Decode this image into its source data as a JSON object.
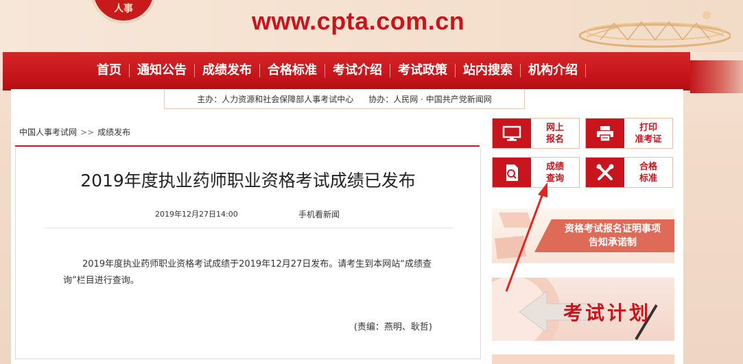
{
  "header": {
    "seal_text": "人事",
    "site_url": "www.cpta.com.cn"
  },
  "nav": {
    "items": [
      "首页",
      "通知公告",
      "成绩发布",
      "合格标准",
      "考试介绍",
      "考试政策",
      "站内搜索",
      "机构介绍"
    ]
  },
  "sponsors": {
    "host": "主办：人力资源和社会保障部人事考试中心",
    "co_host": "协办：人民网 · 中国共产党新闻网"
  },
  "breadcrumb": {
    "home": "中国人事考试网",
    "separator": ">>",
    "current": "成绩发布"
  },
  "article": {
    "title": "2019年度执业药师职业资格考试成绩已发布",
    "date": "2019年12月27日14:00",
    "mobile_link": "手机看新闻",
    "body": "2019年度执业药师职业资格考试成绩于2019年12月27日发布。请考生到本网站“成绩查询”栏目进行查询。",
    "editor": "(责编：燕明、耿哲)"
  },
  "services": {
    "online_signup": "网上\n报名",
    "print_ticket": "打印\n准考证",
    "score_query": "成绩\n查询",
    "pass_standard": "合格\n标准"
  },
  "banners": {
    "commitment": "资格考试报名证明事项\n告知承诺制",
    "exam_plan": "考试计划"
  },
  "colors": {
    "brand_red": "#c8141d",
    "annotation_red": "#e0261f"
  },
  "icons": [
    "monitor-icon",
    "printer-icon",
    "search-document-icon",
    "tools-icon"
  ]
}
